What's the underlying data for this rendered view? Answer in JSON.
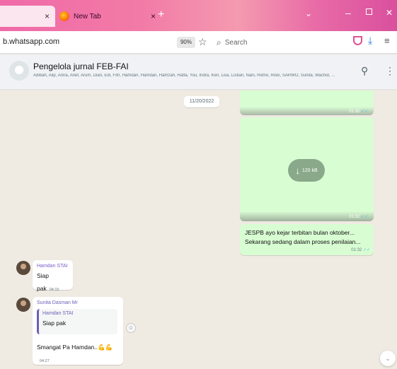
{
  "browser": {
    "tabs": [
      {
        "label": "",
        "close": "×"
      },
      {
        "label": "New Tab",
        "close": "×"
      }
    ],
    "new_tab": "+",
    "url": "b.whatsapp.com",
    "zoom": "90%",
    "search_placeholder": "Search"
  },
  "chat_header": {
    "group_name": "Pengelola jurnal FEB-FAI",
    "members": "Adibah, Alip, Anna, Arief, Arum, Dian, Edi, Fitri, Hamdan, Hamdan, Hamzah, Hatta, You, Indra, Ken, Lisa, Listian, Nani, Retno, Riski, SARWO, Sunita, Wachid, ..."
  },
  "chat": {
    "date_pill": "11/20/2022",
    "outgoing": [
      {
        "kind": "image",
        "time": "01:32"
      },
      {
        "kind": "video",
        "size": "120 kB",
        "time": "01:32"
      },
      {
        "kind": "text",
        "lines": [
          "JESPB ayo kejar terbitan bulan oktober...",
          "Sekarang sedang dalam proses penilaian..."
        ],
        "time": "01:32"
      }
    ],
    "incoming": [
      {
        "sender": "Hamdan STAI",
        "sender_color": "#7e5bc7",
        "text": "Siap pak",
        "time": "04:15"
      },
      {
        "sender": "Sunita Dasman Mr",
        "sender_color": "#7e5bc7",
        "quote_sender": "Hamdan STAI",
        "quote_text": "Siap pak",
        "text": "Smangat Pa Hamdan..💪💪",
        "time": "04:27"
      }
    ]
  },
  "icons": {
    "firefox": "firefox-icon",
    "star": "★",
    "search": "⚲",
    "menu": "≡"
  }
}
